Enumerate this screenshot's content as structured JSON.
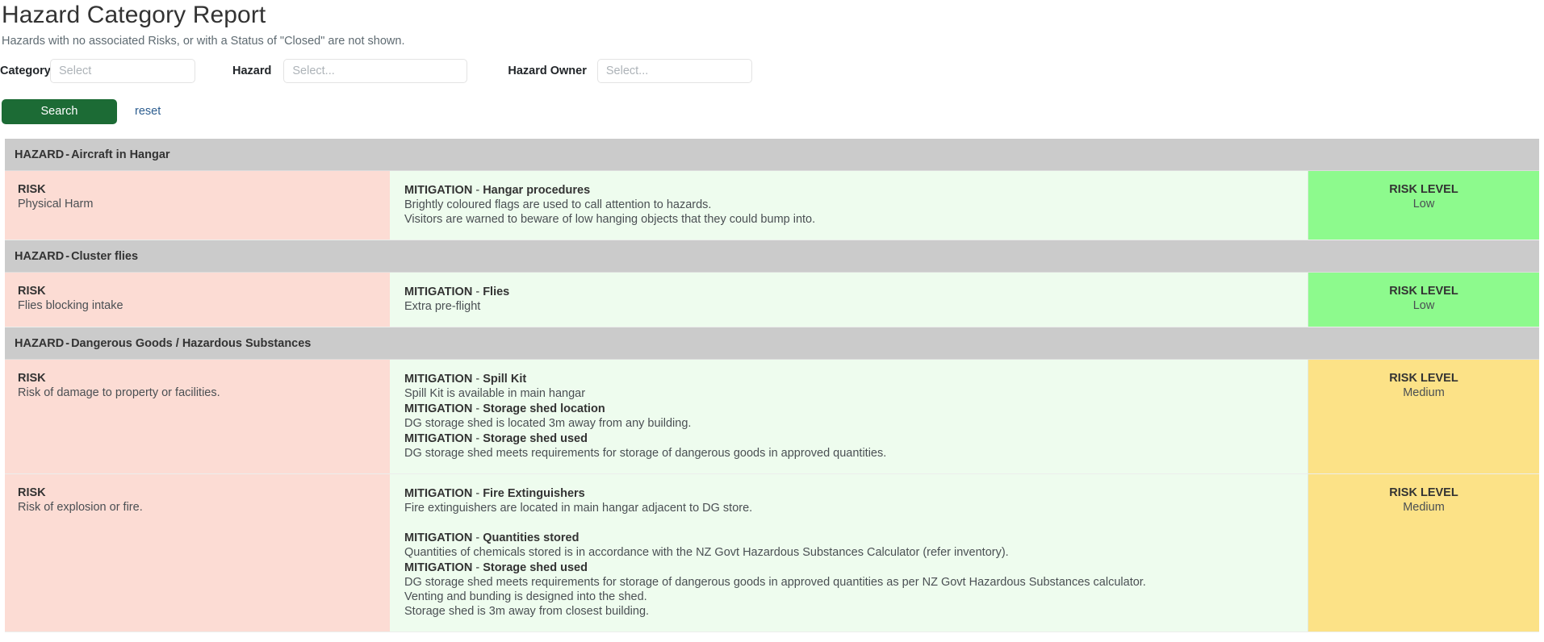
{
  "header": {
    "title": "Hazard Category Report",
    "subtitle": "Hazards with no associated Risks, or with a Status of \"Closed\" are not shown."
  },
  "filters": {
    "category": {
      "label": "Category",
      "value": "",
      "placeholder": "Select"
    },
    "hazard": {
      "label": "Hazard",
      "value": "",
      "placeholder": "Select..."
    },
    "hazard_owner": {
      "label": "Hazard Owner",
      "value": "",
      "placeholder": "Select..."
    }
  },
  "actions": {
    "search_label": "Search",
    "reset_label": "reset"
  },
  "labels": {
    "hazard_prefix": "HAZARD",
    "separator": " - ",
    "risk_heading": "RISK",
    "mitigation_prefix": "MITIGATION",
    "risk_level_heading": "RISK LEVEL"
  },
  "colors": {
    "search_button": "#1c6b35",
    "hazard_header_bg": "#cbcbcb",
    "risk_bg": "#fcdcd4",
    "mitigation_bg": "#eefcee",
    "level_low": "#8dfa8d",
    "level_medium": "#fce287",
    "reset_link": "#2c5d8f"
  },
  "hazards": [
    {
      "name": "Aircraft in Hangar",
      "risks": [
        {
          "risk_text": "Physical Harm",
          "level": "Low",
          "level_class": "low",
          "mitigations": [
            {
              "name": "Hangar procedures",
              "lines": [
                "Brightly coloured flags are used to call attention to hazards.",
                "Visitors are warned to beware of low hanging objects that they could bump into."
              ]
            }
          ]
        }
      ]
    },
    {
      "name": "Cluster flies",
      "risks": [
        {
          "risk_text": "Flies blocking intake",
          "level": "Low",
          "level_class": "low",
          "mitigations": [
            {
              "name": "Flies",
              "lines": [
                "Extra pre-flight"
              ]
            }
          ]
        }
      ]
    },
    {
      "name": "Dangerous Goods / Hazardous Substances",
      "risks": [
        {
          "risk_text": "Risk of damage to property or facilities.",
          "level": "Medium",
          "level_class": "medium",
          "mitigations": [
            {
              "name": "Spill Kit",
              "lines": [
                "Spill Kit is available in main hangar"
              ]
            },
            {
              "name": "Storage shed location",
              "lines": [
                "DG storage shed is located 3m away from any building."
              ]
            },
            {
              "name": "Storage shed used",
              "lines": [
                "DG storage shed meets requirements for storage of dangerous goods in approved quantities."
              ]
            }
          ]
        },
        {
          "risk_text": "Risk of explosion or fire.",
          "level": "Medium",
          "level_class": "medium",
          "mitigations": [
            {
              "name": "Fire Extinguishers",
              "lines": [
                "Fire extinguishers are located in main hangar adjacent to DG store.",
                ""
              ]
            },
            {
              "name": "Quantities stored",
              "lines": [
                "Quantities of chemicals stored is in accordance with the NZ Govt Hazardous Substances Calculator (refer inventory)."
              ]
            },
            {
              "name": "Storage shed used",
              "lines": [
                "DG storage shed meets requirements for storage of dangerous goods in approved quantities as per NZ Govt Hazardous Substances calculator.",
                "Venting and bunding is designed into the shed.",
                "Storage shed is 3m away from closest building."
              ]
            }
          ]
        }
      ]
    }
  ]
}
